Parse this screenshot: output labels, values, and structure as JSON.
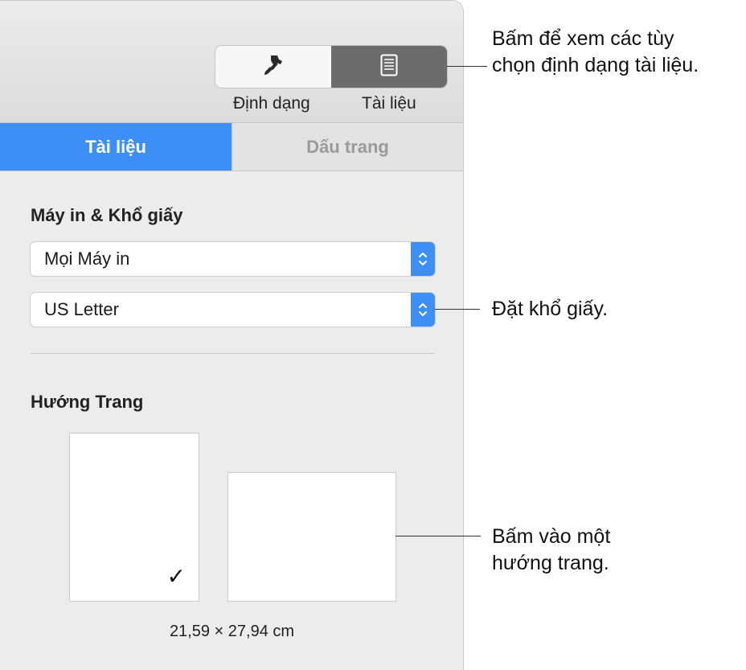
{
  "toolbar": {
    "format_label": "Định dạng",
    "document_label": "Tài liệu",
    "format_icon": "paintbrush-icon",
    "document_icon": "document-icon"
  },
  "tabs": {
    "document": "Tài liệu",
    "bookmarks": "Dấu trang"
  },
  "printer_paper": {
    "title": "Máy in & Khổ giấy",
    "printer_value": "Mọi Máy in",
    "paper_value": "US Letter"
  },
  "orientation": {
    "title": "Hướng Trang",
    "selected": "portrait",
    "checkmark": "✓",
    "dimensions": "21,59 × 27,94 cm"
  },
  "callouts": {
    "document_button_line1": "Bấm để xem các tùy",
    "document_button_line2": "chọn định dạng tài liệu.",
    "paper_size": "Đặt khổ giấy.",
    "orientation_line1": "Bấm vào một",
    "orientation_line2": "hướng trang."
  },
  "colors": {
    "accent": "#3d8ef5",
    "selected_segment": "#6c6c6c",
    "panel_bg": "#ececec"
  }
}
